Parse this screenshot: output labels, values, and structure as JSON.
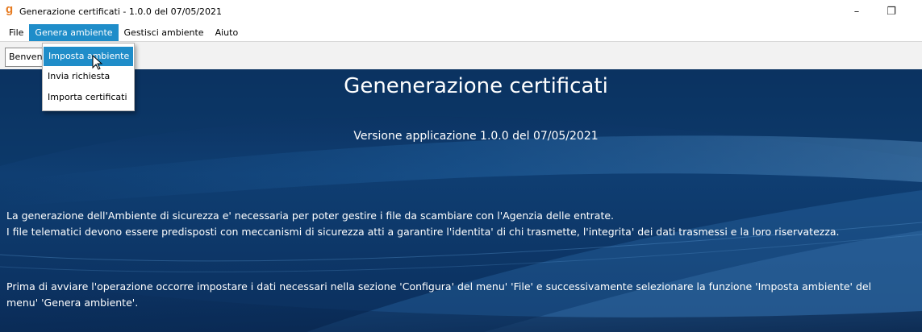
{
  "window": {
    "logo": "g",
    "title": "Generazione certificati - 1.0.0 del 07/05/2021",
    "minimize_glyph": "–",
    "restore_glyph": "❐"
  },
  "menubar": {
    "items": [
      {
        "label": "File"
      },
      {
        "label": "Genera ambiente",
        "active": true
      },
      {
        "label": "Gestisci ambiente"
      },
      {
        "label": "Aiuto"
      }
    ]
  },
  "tab": {
    "label": "Benvenuto"
  },
  "dropdown": {
    "items": [
      {
        "label": "Imposta ambiente",
        "highlighted": true
      },
      {
        "label": "Invia richiesta"
      },
      {
        "label": "Importa certificati"
      }
    ]
  },
  "main": {
    "heading": "Genenerazione certificati",
    "version": "Versione applicazione 1.0.0 del 07/05/2021",
    "paragraph1_line1": "La generazione dell'Ambiente di sicurezza e' necessaria per poter gestire i file da scambiare con l'Agenzia delle entrate.",
    "paragraph1_line2": "I file telematici devono essere predisposti con meccanismi di sicurezza atti a garantire l'identita' di chi trasmette, l'integrita' dei dati trasmessi e la loro riservatezza.",
    "paragraph2": "Prima di avviare l'operazione occorre impostare i dati necessari nella sezione 'Configura' del menu' 'File' e successivamente selezionare la funzione 'Imposta ambiente' del menu' 'Genera ambiente'."
  },
  "colors": {
    "accent": "#1f8dc9",
    "background_dark": "#0a2d5a",
    "logo": "#e67a1f"
  }
}
